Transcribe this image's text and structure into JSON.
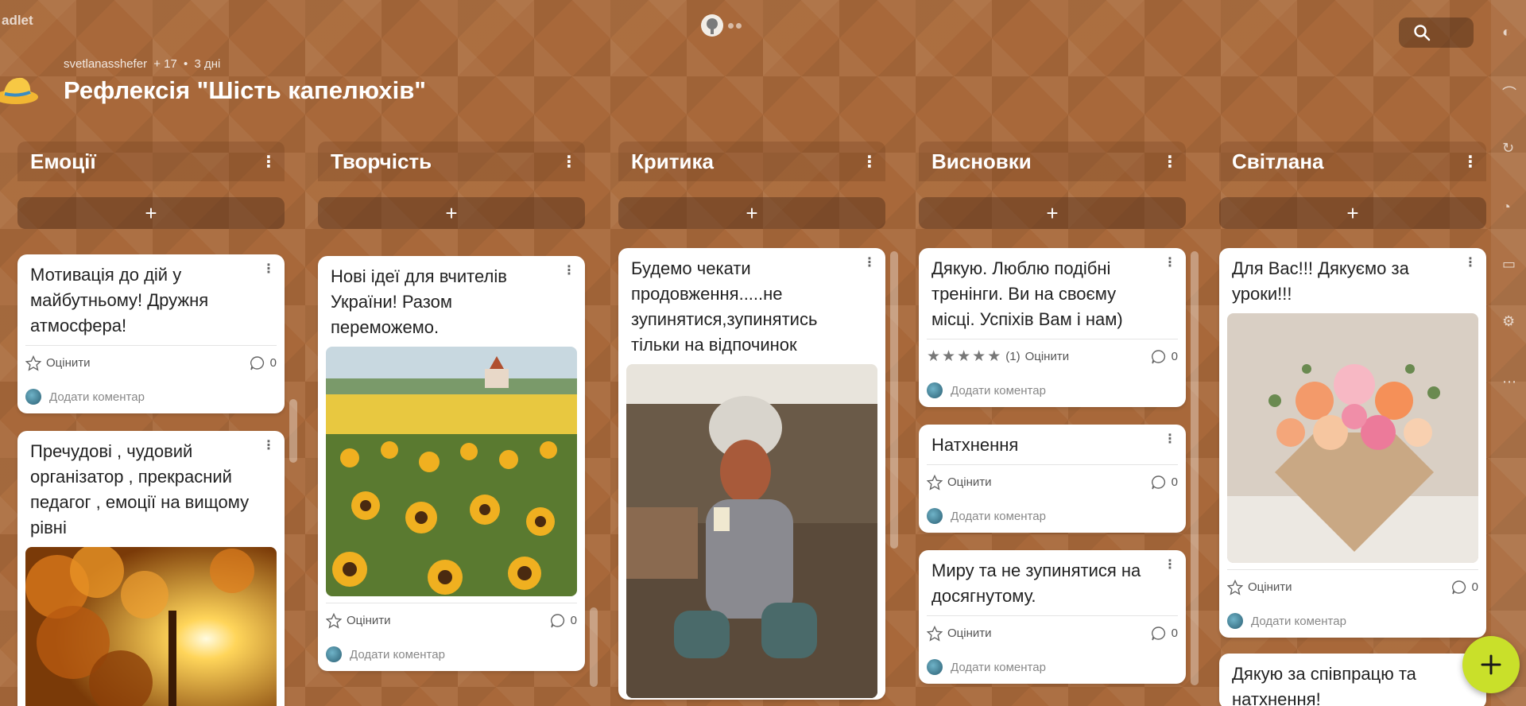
{
  "app": {
    "logo_text": "adlet"
  },
  "topbar": {
    "search_icon": "search-icon"
  },
  "header": {
    "author": "svetlanasshefer",
    "collaborators": "+ 17",
    "separator": "•",
    "age": "3 дні",
    "title": "Рефлексія \"Шість капелюхів\""
  },
  "common": {
    "rate_label": "Оцінити",
    "add_comment": "Додати коментар",
    "add_symbol": "+",
    "more_symbol": "⋮"
  },
  "columns": [
    {
      "title": "Емоції",
      "cards": [
        {
          "text": "Мотивація до дій у майбутньому! Дружня атмосфера!",
          "comments": "0"
        },
        {
          "text": "Пречудові , чудовий організатор , прекрасний педагог , емоції на вищому рівні",
          "image": "autumn-sun-leaves-image"
        }
      ]
    },
    {
      "title": "Творчість",
      "cards": [
        {
          "text": "Нові ідеї для вчителів України! Разом переможемо.",
          "image": "sunflower-field-image",
          "comments": "0"
        }
      ]
    },
    {
      "title": "Критика",
      "cards": [
        {
          "text": "Будемо чекати продовження.....не зупинятися,зупинятись тільки на відпочинок",
          "image": "dog-in-towel-image"
        }
      ]
    },
    {
      "title": "Висновки",
      "cards": [
        {
          "text": "Дякую. Люблю подібні тренінги. Ви на своєму місці. Успіхів Вам і нам)",
          "rating_count": "(1)",
          "stars": 5,
          "comments": "0"
        },
        {
          "text": "Натхнення",
          "comments": "0"
        },
        {
          "text": "Миру та не зупинятися на досягнутому.",
          "comments": "0"
        }
      ]
    },
    {
      "title": "Світлана",
      "cards": [
        {
          "text": "Для Вас!!! Дякуємо за уроки!!!",
          "image": "flower-bouquet-image",
          "comments": "0"
        },
        {
          "text": "Дякую за співпрацю та натхнення!"
        }
      ]
    }
  ],
  "colors": {
    "background": "#a8683a",
    "fab": "#c9e02a",
    "card": "#ffffff"
  }
}
